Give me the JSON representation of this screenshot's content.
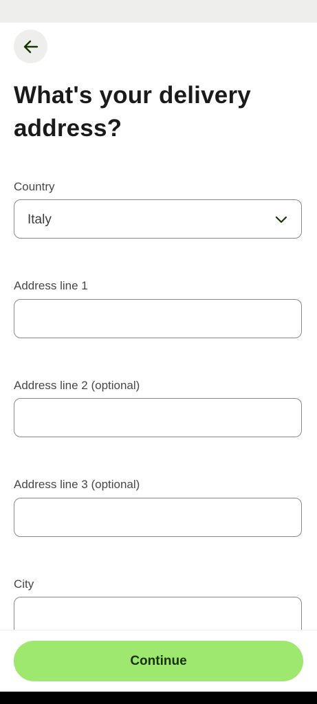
{
  "header": {
    "back_icon": "arrow-left-icon",
    "title": "What's your delivery address?"
  },
  "form": {
    "country": {
      "label": "Country",
      "value": "Italy",
      "icon": "chevron-down-icon"
    },
    "address_line_1": {
      "label": "Address line 1",
      "value": ""
    },
    "address_line_2": {
      "label": "Address line 2 (optional)",
      "value": ""
    },
    "address_line_3": {
      "label": "Address line 3 (optional)",
      "value": ""
    },
    "city": {
      "label": "City",
      "value": ""
    }
  },
  "footer": {
    "continue_label": "Continue"
  },
  "colors": {
    "accent": "#9fe870",
    "accent_text": "#163300",
    "back_button_bg": "#eeefec",
    "field_border": "#878a86"
  }
}
